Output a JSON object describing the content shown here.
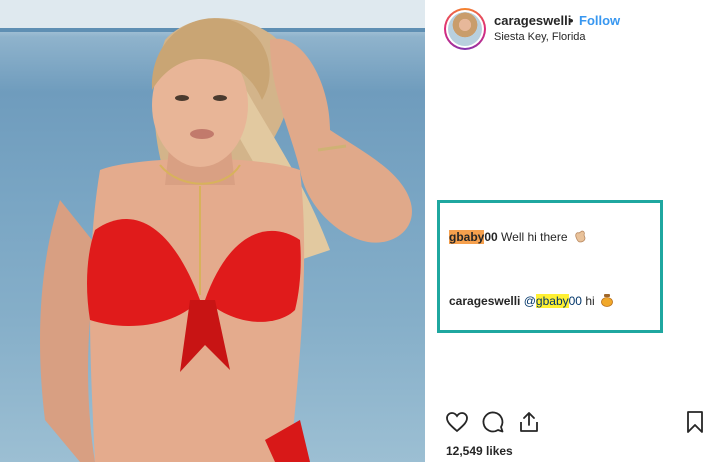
{
  "post": {
    "username": "carageswelli",
    "separator": "•",
    "follow_label": "Follow",
    "location": "Siesta Key, Florida",
    "likes": "12,549 likes"
  },
  "comments": [
    {
      "user_prefix": "gbaby",
      "user_suffix": "00",
      "text": " Well hi there",
      "emoji": "clap-hand-emoji"
    },
    {
      "user": "carageswelli",
      "mention_at": "@",
      "mention_highlight": "gbaby",
      "mention_suffix": "00",
      "text": " hi",
      "emoji": "honey-pot-emoji"
    }
  ],
  "icons": {
    "like": "heart-icon",
    "comment": "comment-icon",
    "share": "share-icon",
    "save": "bookmark-icon"
  },
  "colors": {
    "follow": "#3897f0",
    "box_border": "#1fa7a0",
    "highlight_orange": "#f6a04d",
    "highlight_yellow": "#fff033"
  }
}
